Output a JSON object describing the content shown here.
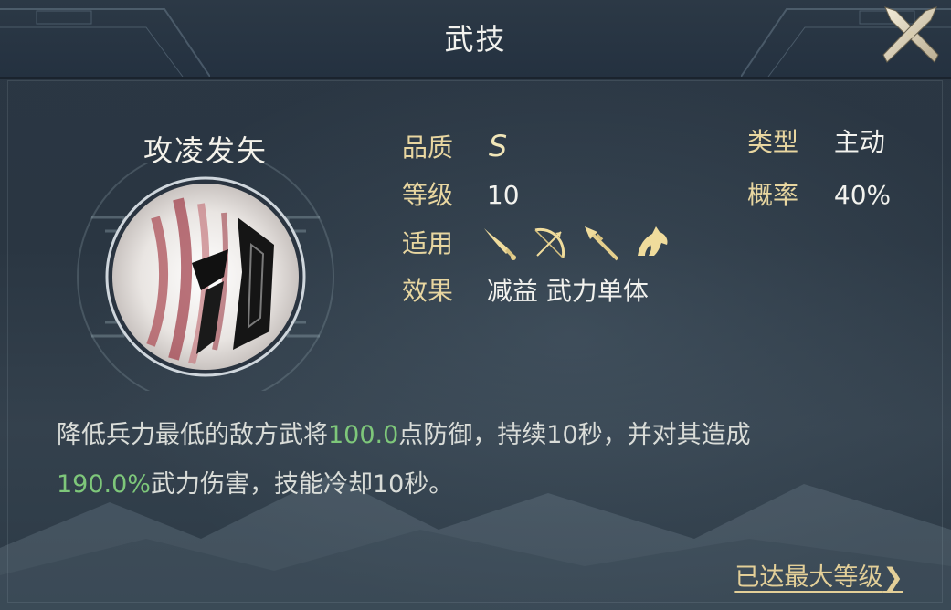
{
  "header": {
    "title": "武技"
  },
  "skill": {
    "name": "攻凌发矢",
    "quality_label": "品质",
    "quality_value": "S",
    "level_label": "等级",
    "level_value": "10",
    "applicable_label": "适用",
    "applicable_icons": [
      "sword-icon",
      "bow-icon",
      "spear-icon",
      "horse-icon"
    ],
    "effect_label": "效果",
    "effect_value": "减益 武力单体",
    "type_label": "类型",
    "type_value": "主动",
    "rate_label": "概率",
    "rate_value": "40%"
  },
  "description": {
    "part1": "降低兵力最低的敌方武将",
    "highlight1": "100.0",
    "part2": "点防御，持续10秒，并对其造成",
    "highlight2": "190.0%",
    "part3": "武力伤害，技能冷却10秒。"
  },
  "footer": {
    "max_level_link": "已达最大等级"
  },
  "colors": {
    "label_gold": "#e8d6a0",
    "highlight_green": "#7ec77a",
    "text_white": "#f2f2ee"
  }
}
